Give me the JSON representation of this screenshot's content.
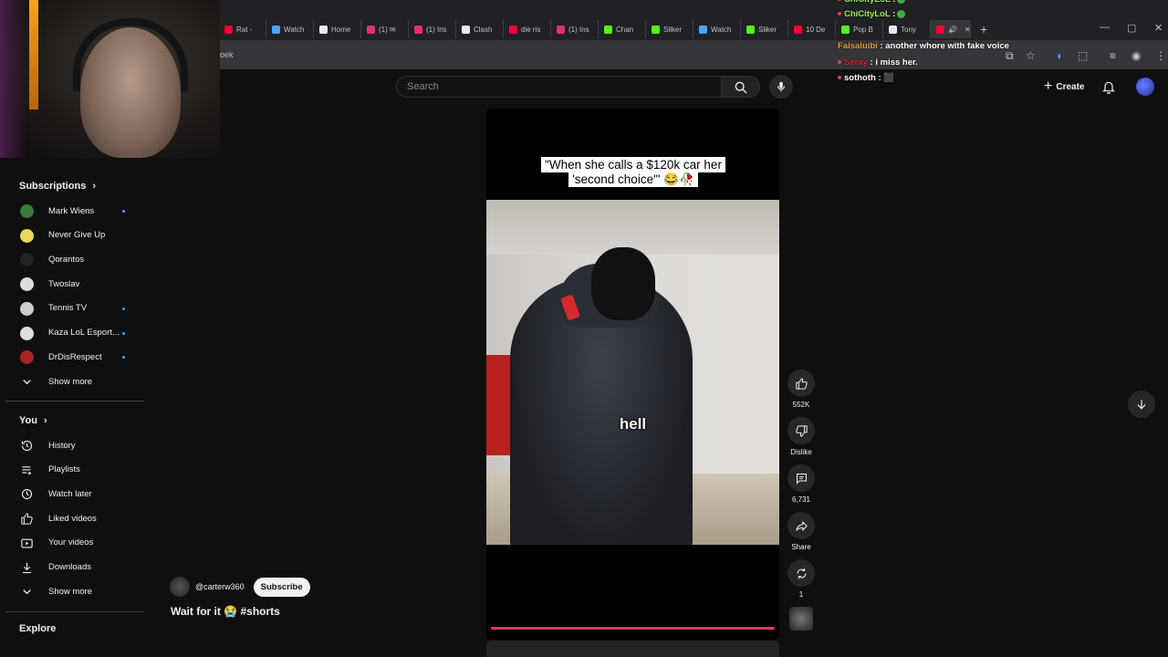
{
  "browser": {
    "tabs": [
      {
        "label": "Rat -",
        "icon": "youtube-icon",
        "color": "#ff0033"
      },
      {
        "label": "Watch",
        "icon": "app-icon",
        "color": "#4aa3ff"
      },
      {
        "label": "Home",
        "icon": "x-icon",
        "color": "#e8eaed"
      },
      {
        "label": "(1) ✉",
        "icon": "instagram-icon",
        "color": "#e1306c"
      },
      {
        "label": "(1) Ins",
        "icon": "instagram-icon",
        "color": "#e1306c"
      },
      {
        "label": "Clash",
        "icon": "x-icon",
        "color": "#e8eaed"
      },
      {
        "label": "die ris",
        "icon": "youtube-icon",
        "color": "#ff0033"
      },
      {
        "label": "(1) Ins",
        "icon": "instagram-icon",
        "color": "#e1306c"
      },
      {
        "label": "Chan",
        "icon": "kick-icon",
        "color": "#53fc18"
      },
      {
        "label": "Sliker",
        "icon": "kick-icon",
        "color": "#53fc18"
      },
      {
        "label": "Watch",
        "icon": "app-icon",
        "color": "#4aa3ff"
      },
      {
        "label": "Sliker",
        "icon": "kick-icon",
        "color": "#53fc18"
      },
      {
        "label": "10 De",
        "icon": "youtube-icon",
        "color": "#ff0033"
      },
      {
        "label": "Pop B",
        "icon": "app-icon",
        "color": "#53fc18"
      },
      {
        "label": "Tony",
        "icon": "x-icon",
        "color": "#e8eaed"
      }
    ],
    "url_fragment": "oek"
  },
  "chat": [
    {
      "user": "ChiCityLoL",
      "message": ":",
      "color": "#9cf25c",
      "emote": true
    },
    {
      "user": "ChiCityLoL",
      "message": ":",
      "color": "#9cf25c",
      "emote": true
    },
    {
      "user": "Faisaluibi",
      "message": ": another whore with fake voice",
      "color": "#e0a040",
      "emote": false
    },
    {
      "user": "Seray",
      "message": ": i miss her.",
      "color": "#d62a2a",
      "emote": false
    },
    {
      "user": "sothoth",
      "message": ": ⬛",
      "color": "#ffffff",
      "emote": false
    }
  ],
  "header": {
    "search_placeholder": "Search",
    "create_label": "Create"
  },
  "sidebar": {
    "subscriptions_label": "Subscriptions",
    "channels": [
      {
        "name": "Mark Wiens",
        "live": true,
        "color": "#3a7a3a"
      },
      {
        "name": "Never Give Up",
        "live": false,
        "color": "#e6d85a"
      },
      {
        "name": "Qorantos",
        "live": false,
        "color": "#222222"
      },
      {
        "name": "Twoslav",
        "live": false,
        "color": "#dddddd"
      },
      {
        "name": "Tennis TV",
        "live": true,
        "color": "#cccccc"
      },
      {
        "name": "Kaza LoL Esport...",
        "live": true,
        "color": "#dddddd"
      },
      {
        "name": "DrDisRespect",
        "live": true,
        "color": "#aa2222"
      }
    ],
    "show_more_1": "Show more",
    "you_label": "You",
    "you_items": [
      {
        "label": "History",
        "icon": "history-icon"
      },
      {
        "label": "Playlists",
        "icon": "playlists-icon"
      },
      {
        "label": "Watch later",
        "icon": "watch-later-icon"
      },
      {
        "label": "Liked videos",
        "icon": "like-icon"
      },
      {
        "label": "Your videos",
        "icon": "your-videos-icon"
      },
      {
        "label": "Downloads",
        "icon": "download-icon"
      }
    ],
    "show_more_2": "Show more",
    "explore_label": "Explore"
  },
  "short": {
    "caption": "\"When she calls a $120k car her 'second choice'\" 😂🥀",
    "subtitle": "hell",
    "channel": "@carterw360",
    "subscribe_label": "Subscribe",
    "title": "Wait for it 😭 #shorts",
    "likes": "552K",
    "dislike_label": "Dislike",
    "comments": "6,731",
    "share_label": "Share",
    "remix_count": "1"
  }
}
